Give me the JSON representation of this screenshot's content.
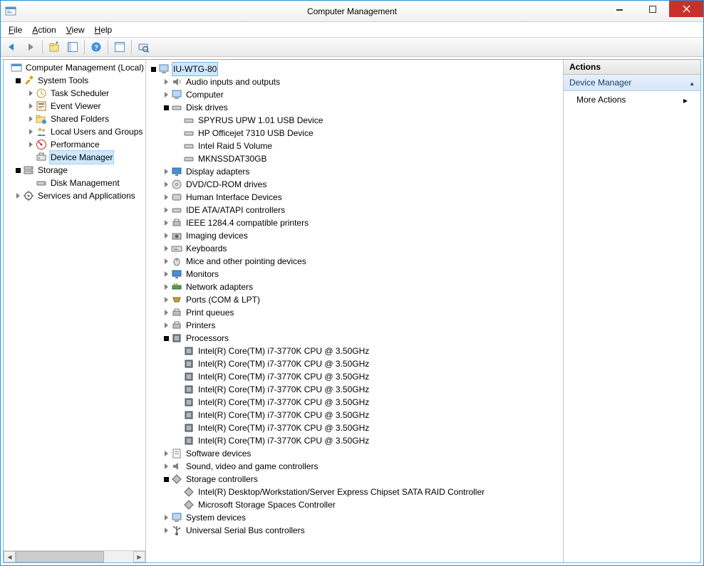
{
  "window": {
    "title": "Computer Management"
  },
  "menu": {
    "file": "File",
    "action": "Action",
    "view": "View",
    "help": "Help"
  },
  "leftTree": {
    "root": "Computer Management (Local)",
    "systemTools": "System Tools",
    "taskScheduler": "Task Scheduler",
    "eventViewer": "Event Viewer",
    "sharedFolders": "Shared Folders",
    "localUsers": "Local Users and Groups",
    "performance": "Performance",
    "deviceManager": "Device Manager",
    "storage": "Storage",
    "diskManagement": "Disk Management",
    "servicesApps": "Services and Applications"
  },
  "deviceTree": {
    "root": "IU-WTG-80",
    "audio": "Audio inputs and outputs",
    "computer": "Computer",
    "diskDrives": "Disk drives",
    "disk1": "SPYRUS UPW 1.01 USB Device",
    "disk2": "HP Officejet 7310 USB Device",
    "disk3": "Intel Raid 5 Volume",
    "disk4": "MKNSSDAT30GB",
    "display": "Display adapters",
    "dvd": "DVD/CD-ROM drives",
    "hid": "Human Interface Devices",
    "ide": "IDE ATA/ATAPI controllers",
    "ieee": "IEEE 1284.4 compatible printers",
    "imaging": "Imaging devices",
    "keyboards": "Keyboards",
    "mice": "Mice and other pointing devices",
    "monitors": "Monitors",
    "network": "Network adapters",
    "ports": "Ports (COM & LPT)",
    "printq": "Print queues",
    "printers": "Printers",
    "processors": "Processors",
    "cpu": "Intel(R) Core(TM) i7-3770K CPU @ 3.50GHz",
    "software": "Software devices",
    "sound": "Sound, video and game controllers",
    "storageCtrl": "Storage controllers",
    "stor1": "Intel(R) Desktop/Workstation/Server Express Chipset SATA RAID Controller",
    "stor2": "Microsoft Storage Spaces Controller",
    "system": "System devices",
    "usb": "Universal Serial Bus controllers"
  },
  "actions": {
    "header": "Actions",
    "section": "Device Manager",
    "more": "More Actions"
  }
}
